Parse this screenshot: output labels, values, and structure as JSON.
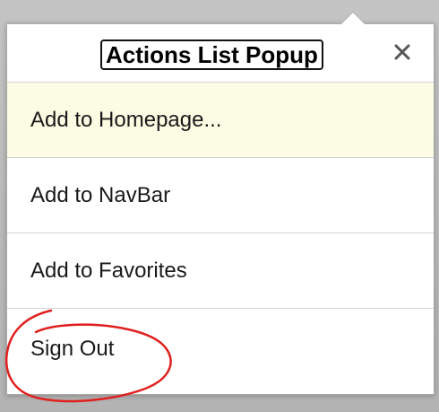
{
  "popup": {
    "title": "Actions List Popup",
    "close_icon": "close-icon",
    "items": [
      {
        "label": "Add to Homepage...",
        "highlighted": true
      },
      {
        "label": "Add to NavBar",
        "highlighted": false
      },
      {
        "label": "Add to Favorites",
        "highlighted": false
      },
      {
        "label": "Sign Out",
        "highlighted": false
      }
    ]
  },
  "colors": {
    "highlight_bg": "#fcfbe3",
    "annotation": "#e0201e",
    "backdrop": "#b9b9b9"
  }
}
